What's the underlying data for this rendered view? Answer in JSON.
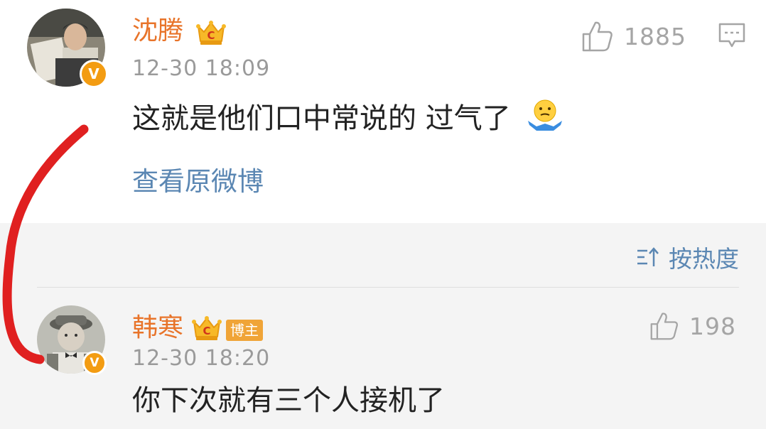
{
  "post": {
    "username": "沈腾",
    "timestamp": "12-30 18:09",
    "content": "这就是他们口中常说的 过气了",
    "view_original_label": "查看原微博",
    "like_count": "1885"
  },
  "comments": {
    "sort_label": "按热度",
    "items": [
      {
        "username": "韩寒",
        "badge": "博主",
        "timestamp": "12-30 18:20",
        "content": "你下次就有三个人接机了",
        "like_count": "198"
      }
    ]
  },
  "verified_badge_letter": "V",
  "colors": {
    "username": "#e8742a",
    "link": "#5b87b3",
    "timestamp": "#9a9a9a",
    "verified": "#f39c12",
    "annotation": "#e02020"
  }
}
